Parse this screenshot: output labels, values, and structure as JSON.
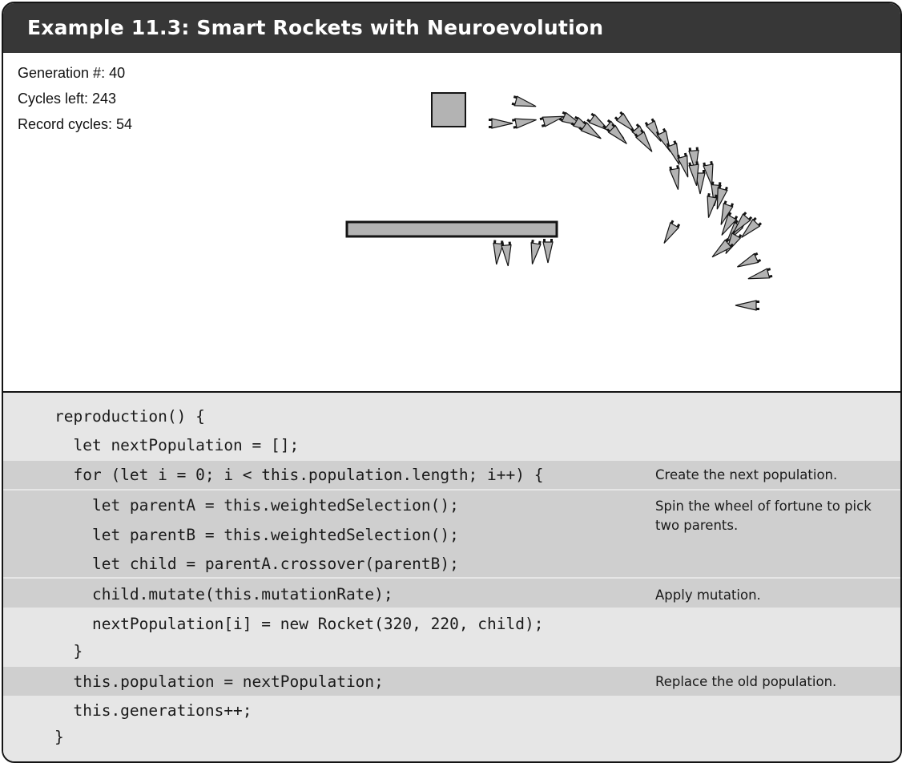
{
  "title": "Example 11.3: Smart Rockets with Neuroevolution",
  "stats": {
    "generation": "Generation #: 40",
    "cycles_left": "Cycles left: 243",
    "record_cycles": "Record cycles: 54"
  },
  "colors": {
    "title_bar": "#373737",
    "code_background": "#e6e6e6",
    "highlight_band": "#cfcfcf",
    "shape_fill": "#b3b3b3",
    "outline": "#141414"
  },
  "code": {
    "lines": [
      "reproduction() {",
      "  let nextPopulation = [];",
      "  for (let i = 0; i < this.population.length; i++) {",
      "    let parentA = this.weightedSelection();",
      "    let parentB = this.weightedSelection();",
      "    let child = parentA.crossover(parentB);",
      "    child.mutate(this.mutationRate);",
      "    nextPopulation[i] = new Rocket(320, 220, child);",
      "  }",
      "  this.population = nextPopulation;",
      "  this.generations++;",
      "}"
    ]
  },
  "annotations": {
    "next_population": "Create the next population.",
    "wheel_of_fortune": "Spin the wheel of fortune to pick two parents.",
    "mutation": "Apply mutation.",
    "replace": "Replace the old population."
  }
}
